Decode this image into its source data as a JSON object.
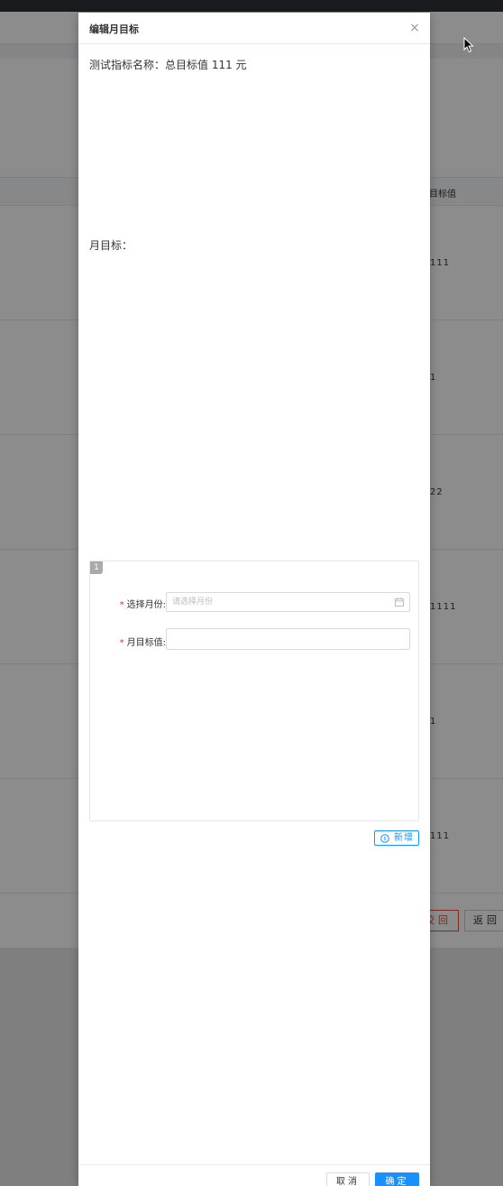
{
  "background": {
    "table_header": "目标值",
    "row_values": [
      "111",
      "1",
      "22",
      "1111",
      "1",
      "111"
    ],
    "buttons": {
      "left_label": "校回",
      "right_label": "返回"
    }
  },
  "modal": {
    "title": "编辑月目标",
    "close_glyph": "×",
    "info_line": "测试指标名称：总目标值 111 元",
    "month_section_label": "月目标：",
    "card": {
      "index": "1",
      "month_label": "选择月份:",
      "month_placeholder": "请选择月份",
      "value_label": "月目标值:",
      "value": ""
    },
    "add_button": "新增",
    "footer": {
      "cancel": "取消",
      "confirm": "确定"
    }
  },
  "colors": {
    "primary": "#1890ff",
    "required": "#f5222d",
    "danger": "#e74c3c"
  }
}
